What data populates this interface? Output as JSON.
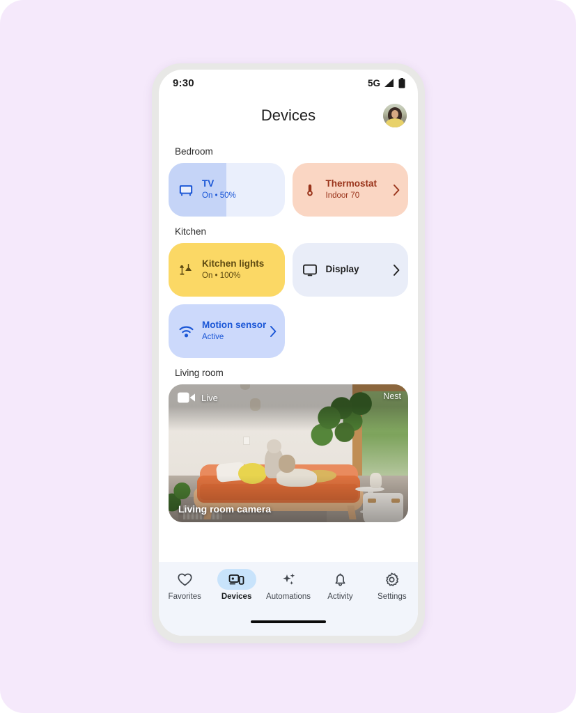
{
  "status_bar": {
    "time": "9:30",
    "network": "5G",
    "signal_icon": "signal-bars-icon",
    "battery_icon": "battery-full-icon"
  },
  "app_bar": {
    "title": "Devices",
    "avatar_name": "account-avatar"
  },
  "sections": [
    {
      "id": "bedroom",
      "title": "Bedroom",
      "rows": [
        [
          {
            "name": "TV",
            "state": "On • 50%",
            "icon": "tv-icon",
            "fill_percent": 50,
            "chevron": false,
            "palette": "c-tv",
            "bg": "#eaeffc",
            "fill_color": "#c5d4f7",
            "text_color": "#1a56d6"
          },
          {
            "name": "Thermostat",
            "state": "Indoor 70",
            "icon": "thermometer-icon",
            "fill_percent": 0,
            "chevron": true,
            "palette": "c-thermo",
            "bg": "#fad6c3",
            "text_color": "#99331a"
          }
        ]
      ]
    },
    {
      "id": "kitchen",
      "title": "Kitchen",
      "rows": [
        [
          {
            "name": "Kitchen lights",
            "state": "On • 100%",
            "icon": "lamp-icon",
            "fill_percent": 100,
            "chevron": false,
            "palette": "c-lights",
            "bg": "#fbe08a",
            "fill_color": "#fbd865",
            "text_color": "#5e4a12"
          },
          {
            "name": "Display",
            "state": "",
            "icon": "display-icon",
            "fill_percent": 0,
            "chevron": true,
            "palette": "c-display",
            "bg": "#e9edf8",
            "text_color": "#1f1f1f"
          }
        ],
        [
          {
            "name": "Motion sensor",
            "state": "Active",
            "icon": "motion-sensor-icon",
            "fill_percent": 0,
            "chevron": true,
            "palette": "c-motion",
            "bg": "#ccd9fb",
            "text_color": "#1a56d6"
          }
        ]
      ]
    },
    {
      "id": "living-room",
      "title": "Living room",
      "rows": []
    }
  ],
  "camera": {
    "live_label": "Live",
    "live_icon": "video-camera-icon",
    "brand_label": "Nest",
    "name": "Living room camera"
  },
  "bottom_nav": {
    "items": [
      {
        "label": "Favorites",
        "icon": "heart-icon",
        "active": false
      },
      {
        "label": "Devices",
        "icon": "devices-icon",
        "active": true
      },
      {
        "label": "Automations",
        "icon": "sparkles-icon",
        "active": false
      },
      {
        "label": "Activity",
        "icon": "bell-icon",
        "active": false
      },
      {
        "label": "Settings",
        "icon": "gear-icon",
        "active": false
      }
    ]
  },
  "colors": {
    "page_background": "#f5e9fb",
    "accent_blue": "#1a56d6",
    "nav_selected_pill": "#c8e3fb",
    "nav_background": "#f2f5fb"
  }
}
